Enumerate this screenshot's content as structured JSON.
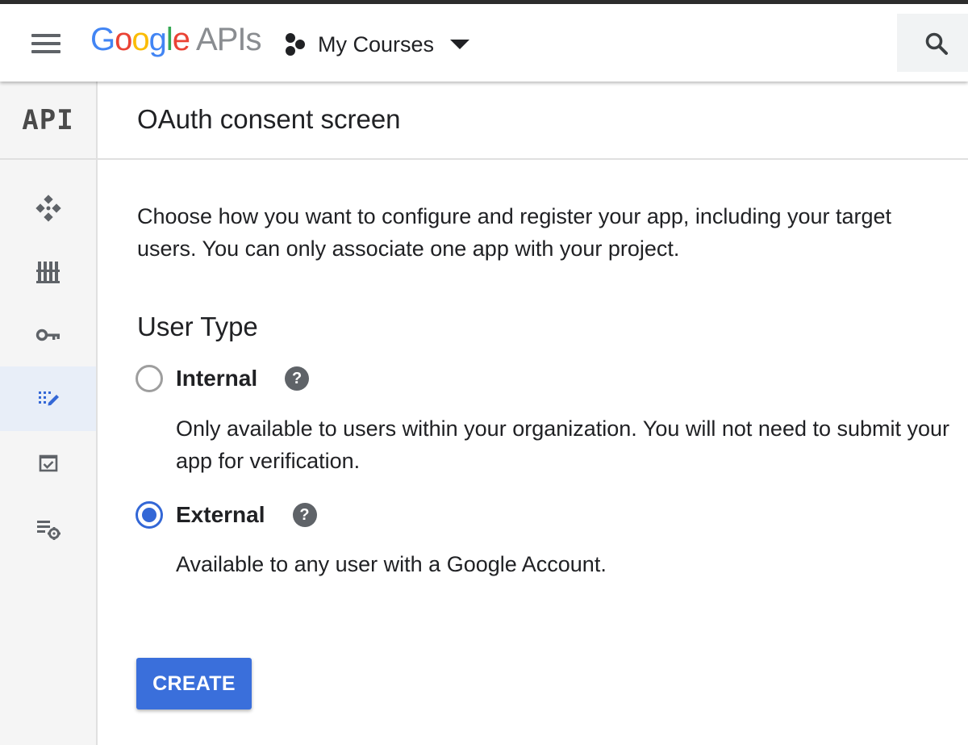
{
  "header": {
    "logo_google_letters": [
      "G",
      "o",
      "o",
      "g",
      "l",
      "e"
    ],
    "logo_suffix": "APIs",
    "project_name": "My Courses"
  },
  "sidebar": {
    "section_label": "API",
    "items": [
      {
        "icon": "dashboard-icon",
        "active": false
      },
      {
        "icon": "library-icon",
        "active": false
      },
      {
        "icon": "key-icon",
        "active": false
      },
      {
        "icon": "consent-screen-icon",
        "active": true
      },
      {
        "icon": "domain-verification-icon",
        "active": false
      },
      {
        "icon": "settings-list-icon",
        "active": false
      }
    ]
  },
  "page": {
    "title": "OAuth consent screen",
    "intro": "Choose how you want to configure and register your app, including your target users. You can only associate one app with your project.",
    "section_title": "User Type"
  },
  "options": [
    {
      "label": "Internal",
      "description": "Only available to users within your organization. You will not need to submit your app for verification.",
      "selected": false
    },
    {
      "label": "External",
      "description": "Available to any user with a Google Account.",
      "selected": true
    }
  ],
  "help_icon_glyph": "?",
  "create_button": "CREATE",
  "colors": {
    "accent": "#3367d6",
    "button": "#3a6fdb",
    "google_blue": "#4285f4",
    "google_red": "#ea4335",
    "google_yellow": "#fbbc05",
    "google_green": "#34a853"
  }
}
